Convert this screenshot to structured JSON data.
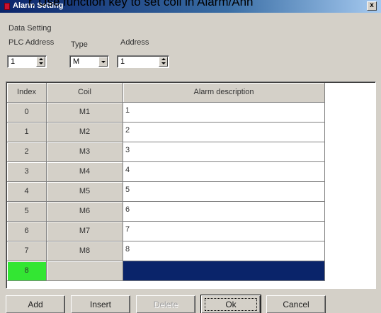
{
  "overlay_caption": "r. Use function key to set coil in Alarm/Ann",
  "window": {
    "title": "Alarm Setting",
    "close_label": "x"
  },
  "data_setting": {
    "group_label": "Data Setting",
    "plc_address": {
      "label": "PLC Address",
      "value": "1"
    },
    "type": {
      "label": "Type",
      "value": "M"
    },
    "address": {
      "label": "Address",
      "value": "1"
    }
  },
  "table": {
    "headers": [
      "Index",
      "Coil",
      "Alarm description"
    ],
    "rows": [
      {
        "index": "0",
        "coil": "M1",
        "desc": "1"
      },
      {
        "index": "1",
        "coil": "M2",
        "desc": "2"
      },
      {
        "index": "2",
        "coil": "M3",
        "desc": "3"
      },
      {
        "index": "3",
        "coil": "M4",
        "desc": "4"
      },
      {
        "index": "4",
        "coil": "M5",
        "desc": "5"
      },
      {
        "index": "5",
        "coil": "M6",
        "desc": "6"
      },
      {
        "index": "6",
        "coil": "M7",
        "desc": "7"
      },
      {
        "index": "7",
        "coil": "M8",
        "desc": "8"
      },
      {
        "index": "8",
        "coil": "",
        "desc": ""
      }
    ]
  },
  "buttons": {
    "add": "Add",
    "insert": "Insert",
    "delete": "Delete",
    "ok": "Ok",
    "cancel": "Cancel"
  },
  "colors": {
    "new_row_index": "#33e633",
    "selected_row": "#0a246a",
    "dialog_bg": "#d4d0c8"
  }
}
